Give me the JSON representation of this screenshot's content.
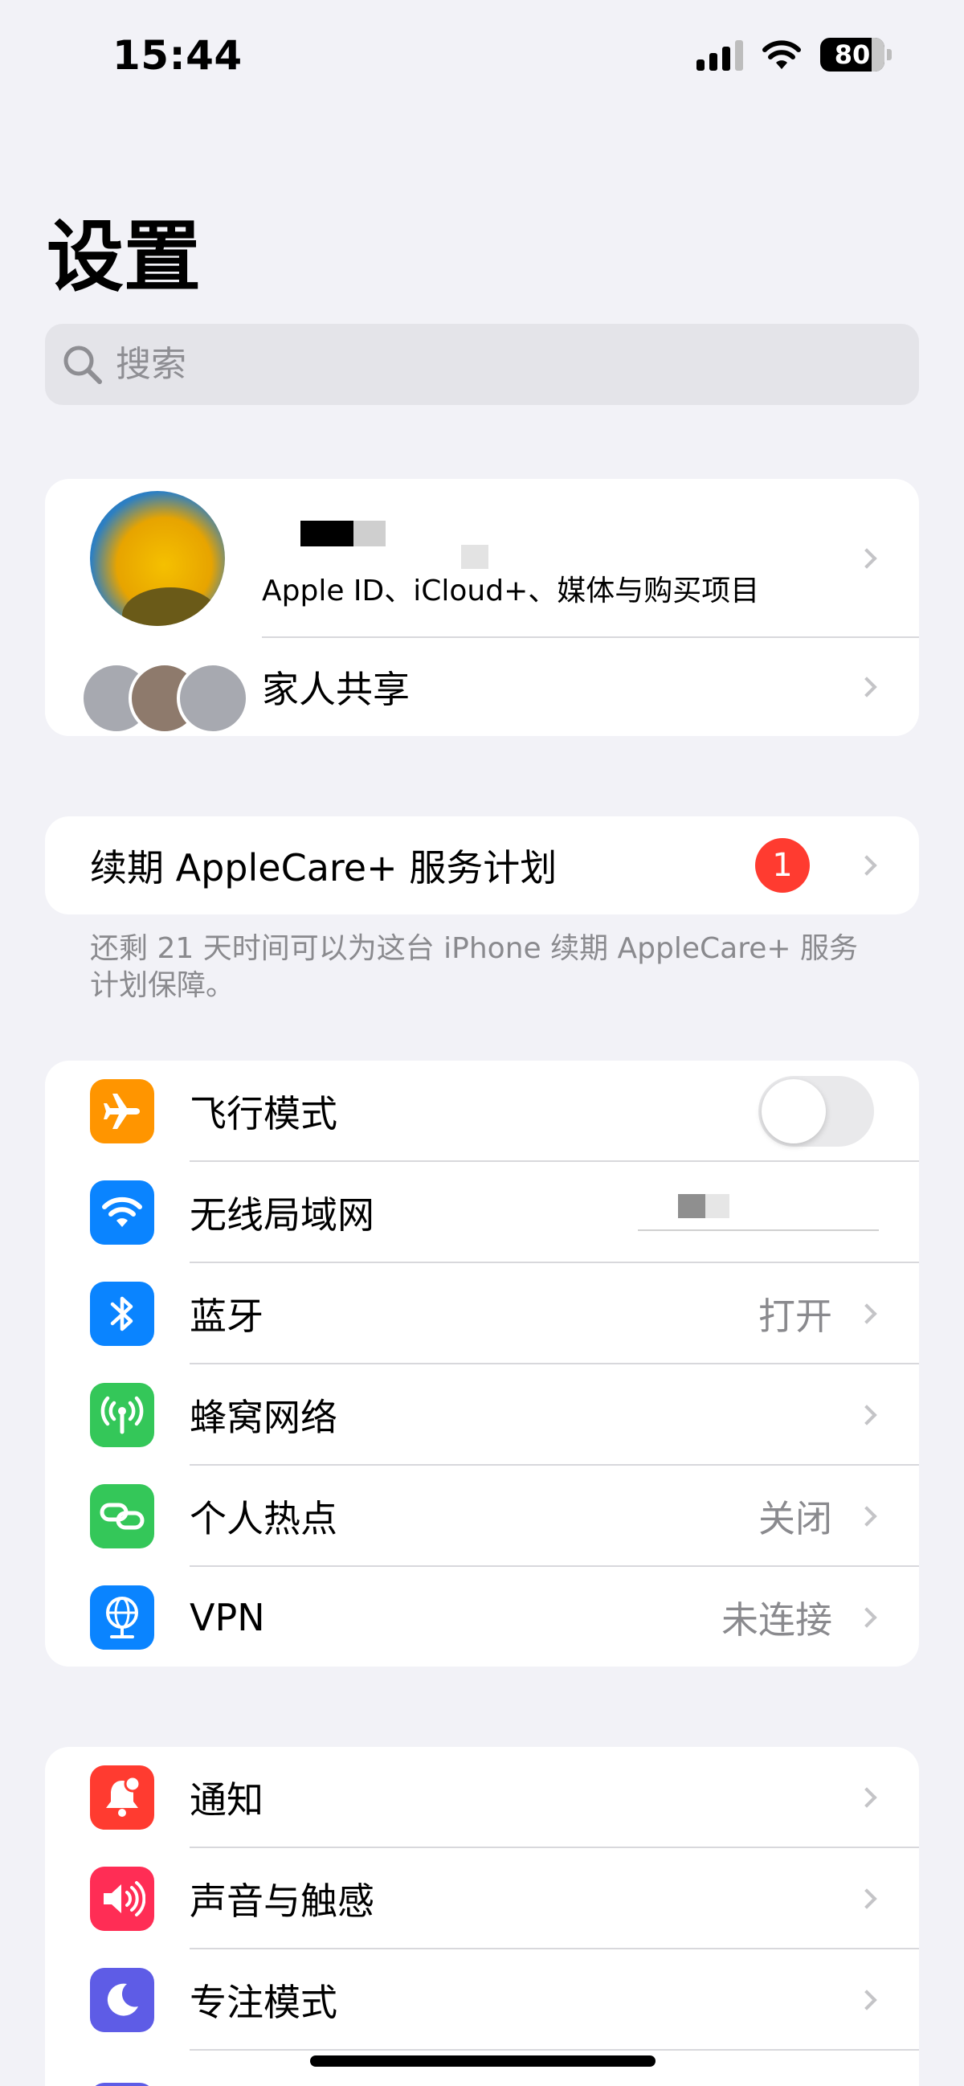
{
  "status_bar": {
    "time": "15:44",
    "battery_percent": 80,
    "battery_label": "80",
    "signal_bars_active": 3
  },
  "page": {
    "title": "设置",
    "search_placeholder": "搜索"
  },
  "profile": {
    "subtitle": "Apple ID、iCloud+、媒体与购买项目",
    "family_label": "家人共享"
  },
  "applecare": {
    "label": "续期 AppleCare+ 服务计划",
    "badge": "1",
    "note": "还剩 21 天时间可以为这台 iPhone 续期 AppleCare+ 服务计划保障。"
  },
  "connectivity": {
    "airplane": {
      "label": "飞行模式",
      "on": false,
      "icon": "airplane-icon"
    },
    "wifi": {
      "label": "无线局域网",
      "value": "",
      "icon": "wifi-icon"
    },
    "bluetooth": {
      "label": "蓝牙",
      "value": "打开",
      "icon": "bluetooth-icon"
    },
    "cellular": {
      "label": "蜂窝网络",
      "icon": "cellular-icon"
    },
    "hotspot": {
      "label": "个人热点",
      "value": "关闭",
      "icon": "hotspot-icon"
    },
    "vpn": {
      "label": "VPN",
      "value": "未连接",
      "icon": "vpn-icon"
    }
  },
  "general": {
    "notifications": {
      "label": "通知",
      "icon": "bell-icon"
    },
    "sounds": {
      "label": "声音与触感",
      "icon": "speaker-icon"
    },
    "focus": {
      "label": "专注模式",
      "icon": "moon-icon"
    }
  },
  "colors": {
    "background": "#F2F2F7",
    "airplane": "#FF9500",
    "wifi": "#0A84FF",
    "bluetooth": "#0A84FF",
    "cellular": "#34C759",
    "hotspot": "#34C759",
    "vpn": "#0A84FF",
    "notifications": "#FF3B30",
    "sounds": "#FF2D55",
    "focus": "#5E5CE6",
    "badge": "#FF3B30"
  }
}
